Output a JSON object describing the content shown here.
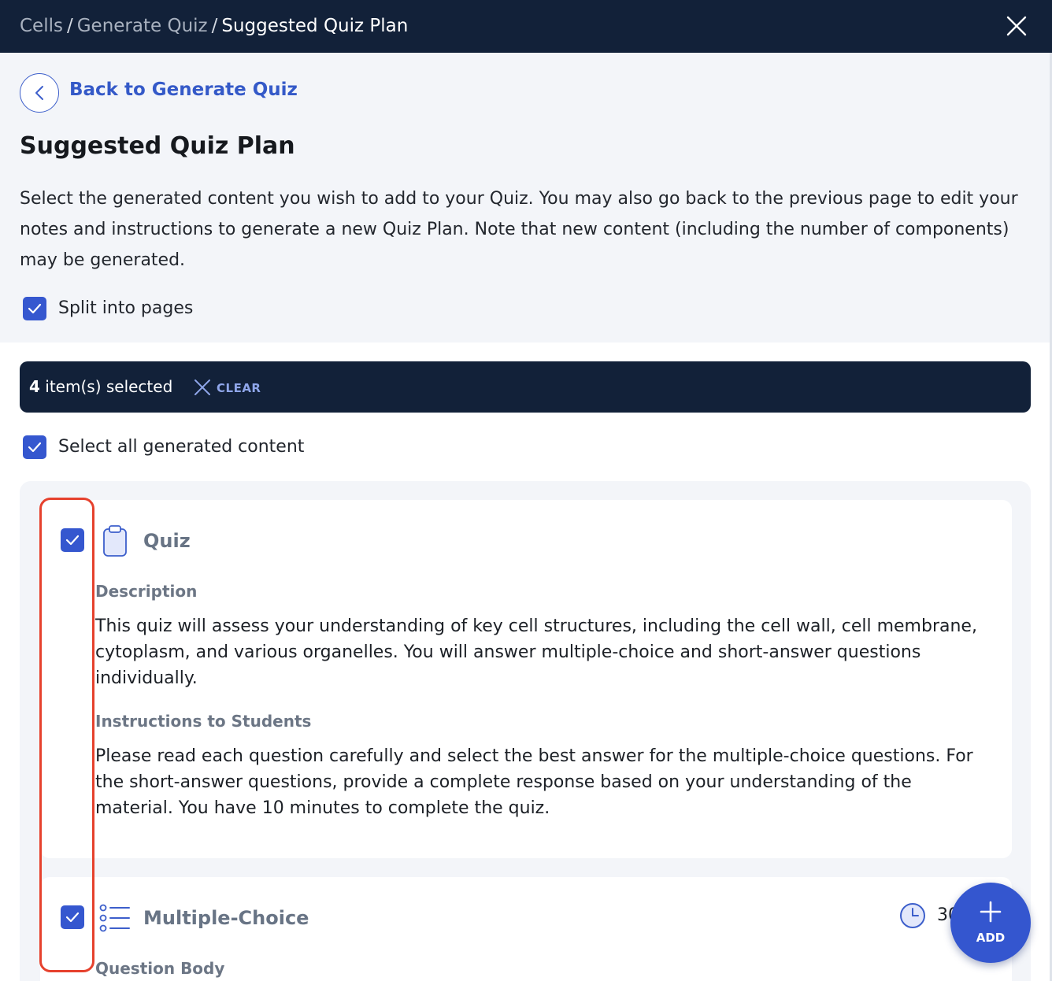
{
  "breadcrumb": {
    "items": [
      "Cells",
      "Generate Quiz",
      "Suggested Quiz Plan"
    ],
    "separator": "/"
  },
  "back": {
    "label": "Back to Generate Quiz"
  },
  "page": {
    "title": "Suggested Quiz Plan",
    "intro": "Select the generated content you wish to add to your Quiz. You may also go back to the previous page to edit your notes and instructions to generate a new Quiz Plan. Note that new content (including the number of components) may be generated."
  },
  "options": {
    "split_pages": {
      "label": "Split into pages",
      "checked": true
    },
    "select_all": {
      "label": "Select all generated content",
      "checked": true
    }
  },
  "selection": {
    "count": "4",
    "suffix": " item(s) selected",
    "clear_label": "CLEAR"
  },
  "cards": [
    {
      "type": "Quiz",
      "icon": "clipboard-icon",
      "checked": true,
      "description_label": "Description",
      "description": "This quiz will assess your understanding of key cell structures, including the cell wall, cell membrane, cytoplasm, and various organelles. You will answer multiple-choice and short-answer questions individually.",
      "instructions_label": "Instructions to Students",
      "instructions": "Please read each question carefully and select the best answer for the multiple-choice questions. For the short-answer questions, provide a complete response based on your understanding of the material. You have 10 minutes to complete the quiz."
    },
    {
      "type": "Multiple-Choice",
      "icon": "list-icon",
      "checked": true,
      "duration_icon": "clock-icon",
      "duration": "30",
      "body_label": "Question Body"
    }
  ],
  "fab": {
    "label": "ADD",
    "icon": "plus-icon"
  },
  "colors": {
    "header_bg": "#122139",
    "accent": "#3557cf",
    "link": "#3459c8",
    "highlight": "#e6412d",
    "panel_bg": "#f3f5f9"
  }
}
